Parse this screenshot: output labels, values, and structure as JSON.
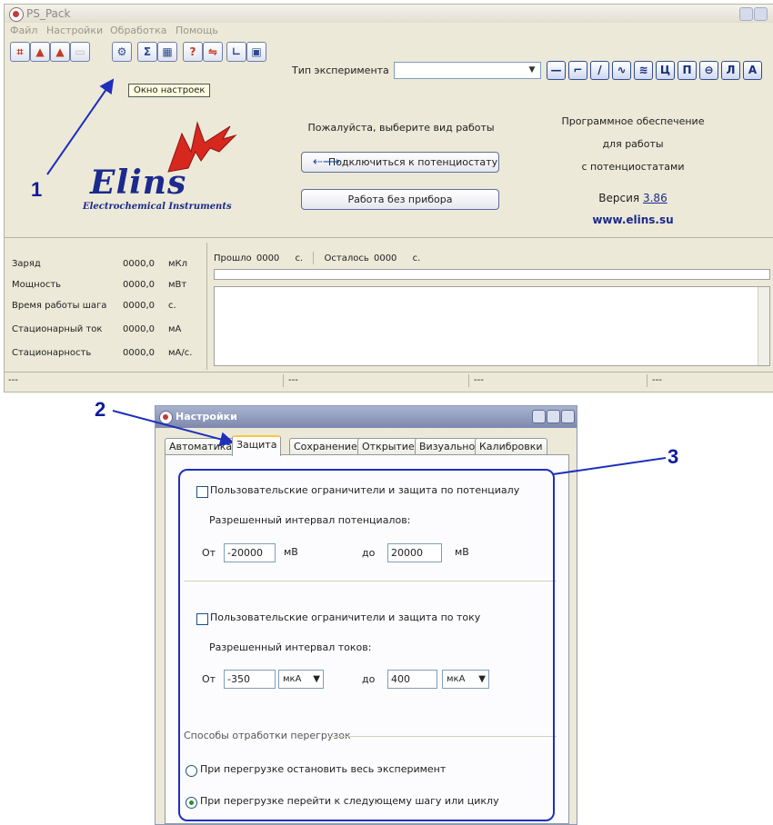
{
  "main_window": {
    "title": "PS_Pack",
    "menu": [
      "Файл",
      "Настройки",
      "Обработка",
      "Помощь"
    ],
    "toolbar_tooltip": "Окно настроек",
    "experiment_type_label": "Тип эксперимента",
    "experiment_type_value": "",
    "mode_buttons": [
      "—",
      "⌐",
      "/",
      "∿",
      "≋",
      "Ц",
      "П",
      "⊖",
      "Л",
      "А"
    ],
    "logo": {
      "brand": "Elins",
      "subtitle": "Electrochemical Instruments"
    },
    "prompt": "Пожалуйста, выберите вид работы",
    "connect_button": "Подключиться к потенциостату",
    "no_device_button": "Работа без прибора",
    "software_info": [
      "Программное обеспечение",
      "для работы",
      "с потенциостатами"
    ],
    "version_label": "Версия",
    "version_value": "3.86",
    "website": "www.elins.su",
    "stats": [
      {
        "label": "Заряд",
        "value": "0000,0",
        "unit": "мКл"
      },
      {
        "label": "Мощность",
        "value": "0000,0",
        "unit": "мВт"
      },
      {
        "label": "Время работы шага",
        "value": "0000,0",
        "unit": "с."
      },
      {
        "label": "Стационарный ток",
        "value": "0000,0",
        "unit": "мА"
      },
      {
        "label": "Стационарность",
        "value": "0000,0",
        "unit": "мА/с."
      }
    ],
    "elapsed_label": "Прошло",
    "elapsed_value": "0000",
    "elapsed_unit": "с.",
    "remaining_label": "Осталось",
    "remaining_value": "0000",
    "remaining_unit": "с.",
    "status": [
      "---",
      "---",
      "---",
      "---"
    ]
  },
  "settings_dialog": {
    "title": "Настройки",
    "tabs": [
      "Автоматика",
      "Защита",
      "Сохранение",
      "Открытие",
      "Визуально",
      "Калибровки"
    ],
    "active_tab": "Защита",
    "potential": {
      "checkbox_label": "Пользовательские ограничители и защита по потенциалу",
      "checked": false,
      "range_label": "Разрешенный интервал потенциалов:",
      "from_label": "От",
      "from_value": "-20000",
      "from_unit": "мВ",
      "to_label": "до",
      "to_value": "20000",
      "to_unit": "мВ"
    },
    "current": {
      "checkbox_label": "Пользовательские ограничители и защита по току",
      "checked": false,
      "range_label": "Разрешенный интервал токов:",
      "from_label": "От",
      "from_value": "-350",
      "from_unit": "мкА",
      "to_label": "до",
      "to_value": "400",
      "to_unit": "мкА"
    },
    "overload": {
      "group_label": "Способы отработки перегрузок",
      "options": [
        {
          "label": "При перегрузке остановить весь эксперимент",
          "selected": false
        },
        {
          "label": "При перегрузке перейти к следующему шагу или циклу",
          "selected": true
        }
      ]
    }
  },
  "annotations": [
    "1",
    "2",
    "3"
  ],
  "colors": {
    "annotation": "#1f2fbd",
    "brand": "#1b2a8c",
    "logo_red": "#d6281f"
  }
}
